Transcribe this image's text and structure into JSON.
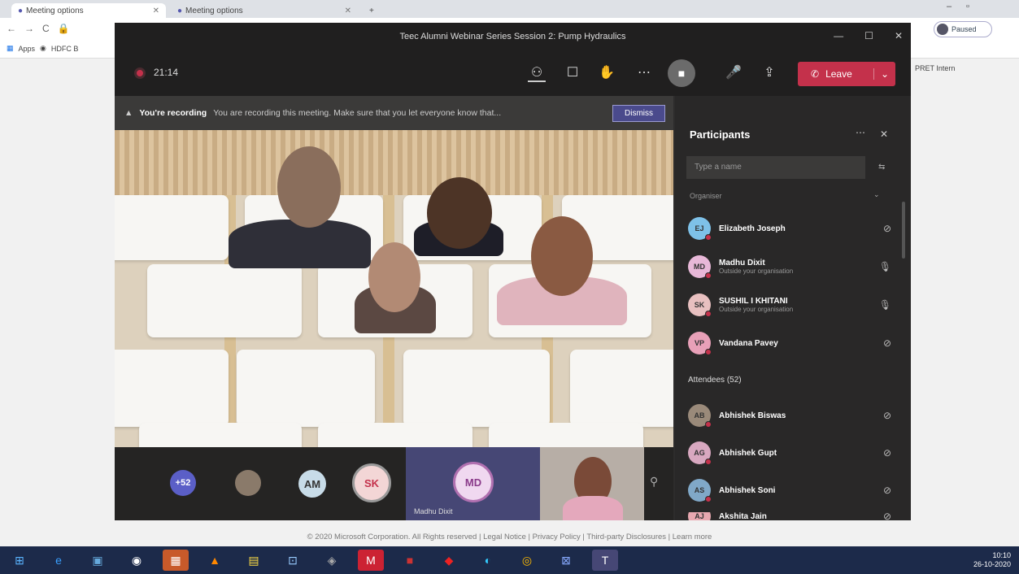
{
  "browser": {
    "tabs": [
      {
        "label": "Meeting options"
      },
      {
        "label": "Meeting options"
      }
    ],
    "bookmarks": [
      "Apps",
      "HDFC B"
    ],
    "profile_label": "Paused",
    "other_bookmark": "PRET Intern"
  },
  "teams": {
    "window_title": "Teec Alumni Webinar Series Session 2: Pump Hydraulics",
    "timer": "21:14",
    "leave_label": "Leave",
    "banner": {
      "title": "You're recording",
      "message": "You are recording this meeting. Make sure that you let everyone know that...",
      "dismiss": "Dismiss"
    },
    "strip": {
      "overflow_count": "+52",
      "avatars": [
        "AM",
        "SK",
        "MD"
      ],
      "featured_name": "Madhu Dixit"
    },
    "panel": {
      "title": "Participants",
      "search_placeholder": "Type a name",
      "organizer_label": "Organiser",
      "presenters": [
        {
          "initials": "EJ",
          "name": "Elizabeth Joseph",
          "sub": "",
          "color": "#7ec1e8"
        },
        {
          "initials": "MD",
          "name": "Madhu Dixit",
          "sub": "Outside your organisation",
          "color": "#e8b8d8"
        },
        {
          "initials": "SK",
          "name": "SUSHIL I KHITANI",
          "sub": "Outside your organisation",
          "color": "#e8c0c0"
        },
        {
          "initials": "VP",
          "name": "Vandana Pavey",
          "sub": "",
          "color": "#e8a0b8"
        }
      ],
      "attendees_label": "Attendees (52)",
      "attendees": [
        {
          "initials": "AB",
          "name": "Abhishek Biswas",
          "color": "#9a8a7a"
        },
        {
          "initials": "AG",
          "name": "Abhishek Gupt",
          "color": "#d8a8c0"
        },
        {
          "initials": "AS",
          "name": "Abhishek Soni",
          "color": "#80a8c8"
        },
        {
          "initials": "AJ",
          "name": "Akshita Jain",
          "color": "#e8a8b0"
        }
      ]
    }
  },
  "footer": "© 2020 Microsoft Corporation. All Rights reserved | Legal Notice | Privacy Policy | Third-party Disclosures | Learn more",
  "tray": {
    "time": "10:10",
    "date": "26-10-2020"
  }
}
